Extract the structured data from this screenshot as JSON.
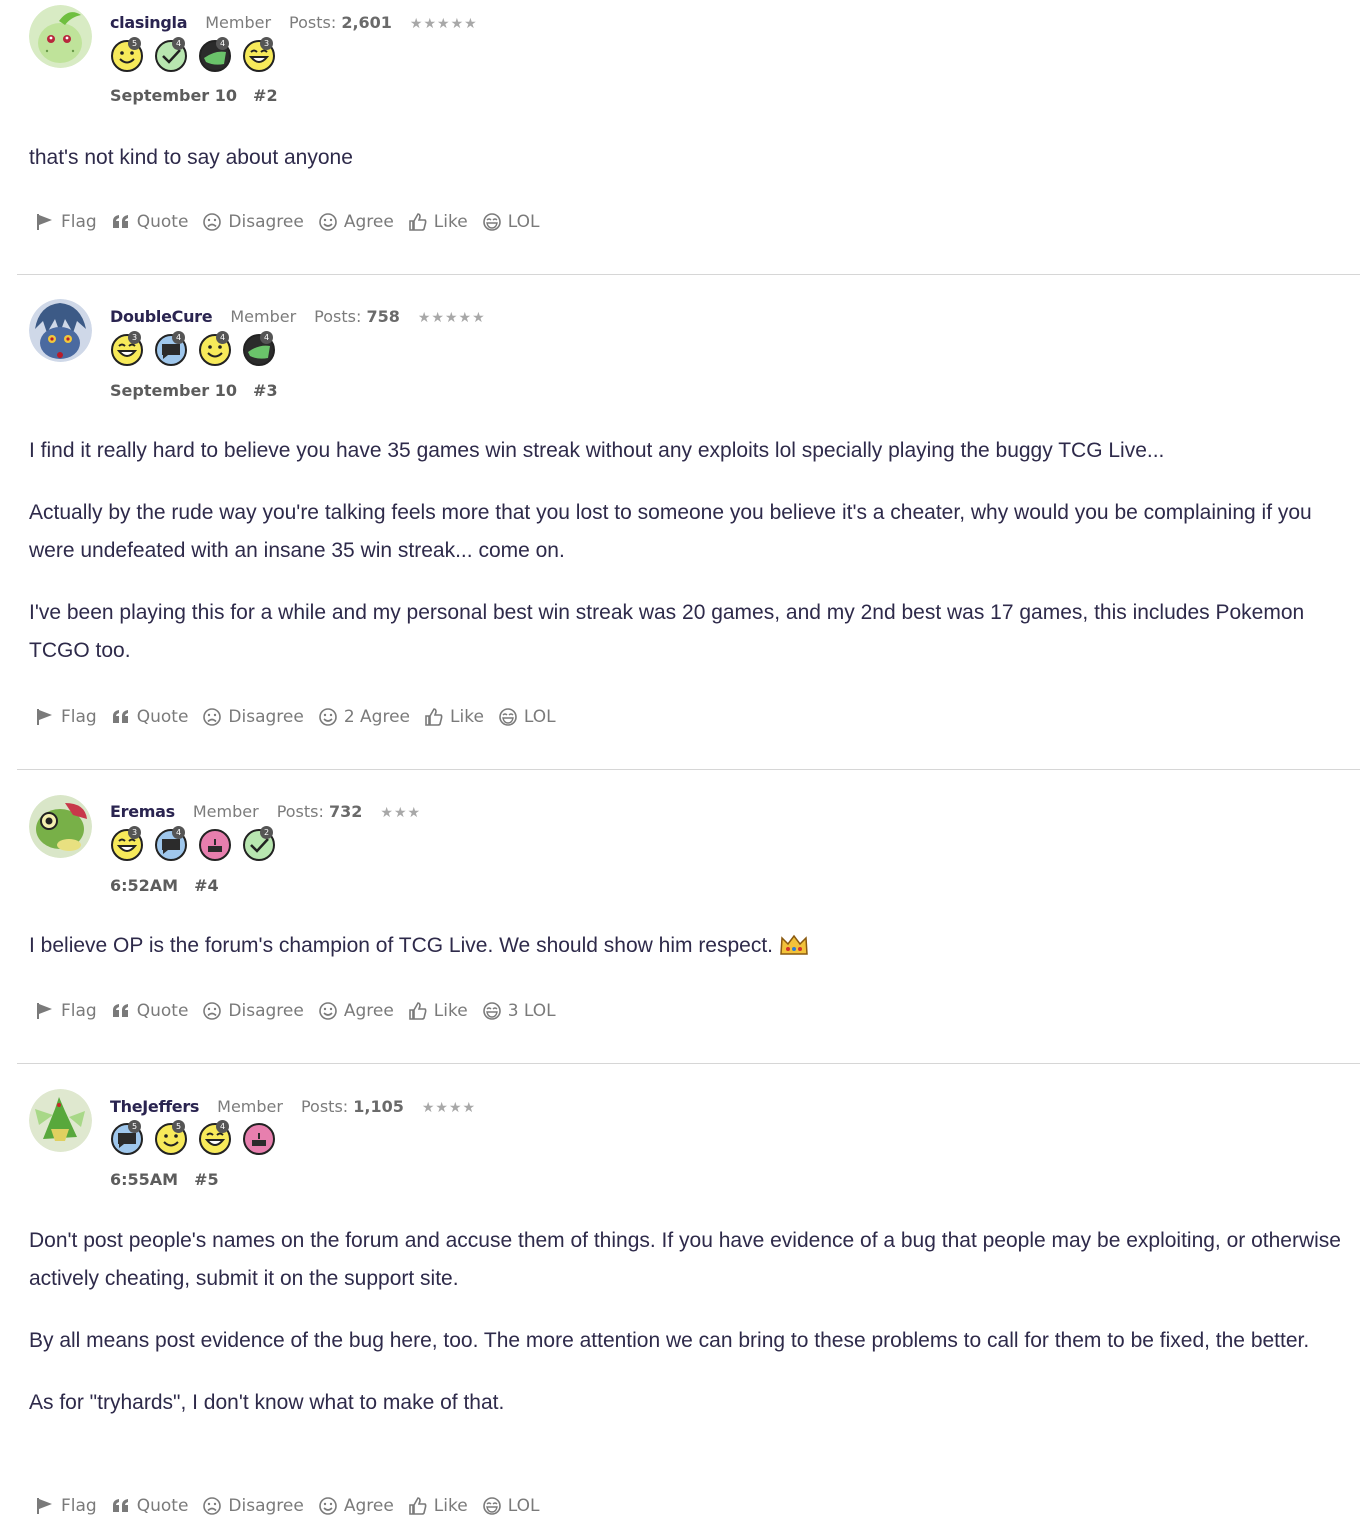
{
  "posts": [
    {
      "username": "clasingla",
      "role": "Member",
      "posts_label": "Posts:",
      "posts_count": "2,601",
      "stars": "★★★★★",
      "date": "September 10",
      "number": "#2",
      "badges": [
        {
          "icon": "smile-badge-icon",
          "count": "5"
        },
        {
          "icon": "check-badge-icon",
          "count": "4"
        },
        {
          "icon": "thumbs-badge-icon",
          "count": "4"
        },
        {
          "icon": "grin-badge-icon",
          "count": "3"
        }
      ],
      "paragraphs": [
        "that's not kind to say about anyone"
      ],
      "actions": {
        "flag": "Flag",
        "quote": "Quote",
        "disagree": "Disagree",
        "agree": "Agree",
        "like": "Like",
        "lol": "LOL"
      }
    },
    {
      "username": "DoubleCure",
      "role": "Member",
      "posts_label": "Posts:",
      "posts_count": "758",
      "stars": "★★★★★",
      "date": "September 10",
      "number": "#3",
      "badges": [
        {
          "icon": "grin-badge-icon",
          "count": "3"
        },
        {
          "icon": "chat-badge-icon",
          "count": "4"
        },
        {
          "icon": "smile-badge-icon",
          "count": "4"
        },
        {
          "icon": "thumbs-badge-icon",
          "count": "4"
        }
      ],
      "paragraphs": [
        "I find it really hard to believe you have 35 games win streak without any exploits lol specially playing the buggy TCG Live...",
        "Actually by the rude way you're talking feels more that you lost to someone you believe it's a cheater, why would you be complaining if you were undefeated with an insane 35 win streak... come on.",
        "I've been playing this for a while and my personal best win streak was 20 games, and my 2nd best was 17 games, this includes Pokemon TCGO too."
      ],
      "actions": {
        "flag": "Flag",
        "quote": "Quote",
        "disagree": "Disagree",
        "agree": "2 Agree",
        "like": "Like",
        "lol": "LOL"
      }
    },
    {
      "username": "Eremas",
      "role": "Member",
      "posts_label": "Posts:",
      "posts_count": "732",
      "stars": "★★★",
      "date": "6:52AM",
      "number": "#4",
      "badges": [
        {
          "icon": "grin-badge-icon",
          "count": "3"
        },
        {
          "icon": "chat-badge-icon",
          "count": "4"
        },
        {
          "icon": "cake-badge-icon",
          "count": ""
        },
        {
          "icon": "check-badge-icon",
          "count": "2"
        }
      ],
      "paragraphs": [
        "I believe OP is the forum's champion of TCG Live. We should show him respect."
      ],
      "actions": {
        "flag": "Flag",
        "quote": "Quote",
        "disagree": "Disagree",
        "agree": "Agree",
        "like": "Like",
        "lol": "3 LOL"
      }
    },
    {
      "username": "TheJeffers",
      "role": "Member",
      "posts_label": "Posts:",
      "posts_count": "1,105",
      "stars": "★★★★",
      "date": "6:55AM",
      "number": "#5",
      "badges": [
        {
          "icon": "chat-badge-icon",
          "count": "5"
        },
        {
          "icon": "smile-badge-icon",
          "count": "5"
        },
        {
          "icon": "grin-badge-icon",
          "count": "4"
        },
        {
          "icon": "cake-badge-icon",
          "count": ""
        }
      ],
      "paragraphs": [
        "Don't post people's names on the forum and accuse them of things. If you have evidence of a bug that people may be exploiting, or otherwise actively cheating, submit it on the support site.",
        "By all means post evidence of the bug here, too. The more attention we can bring to these problems to call for them to be fixed, the better.",
        "As for \"tryhards\", I don't know what to make of that."
      ],
      "actions": {
        "flag": "Flag",
        "quote": "Quote",
        "disagree": "Disagree",
        "agree": "Agree",
        "like": "Like",
        "lol": "LOL"
      }
    }
  ],
  "colors": {
    "username": "#2a2450",
    "body_text": "#2e2a4a",
    "muted": "#7a7a7a",
    "separator": "#d6d6d6",
    "badge_yellow": "#f7ea5a",
    "badge_green": "#b8e6b0",
    "badge_blue": "#9fc7ec",
    "badge_pink": "#e77fae"
  }
}
